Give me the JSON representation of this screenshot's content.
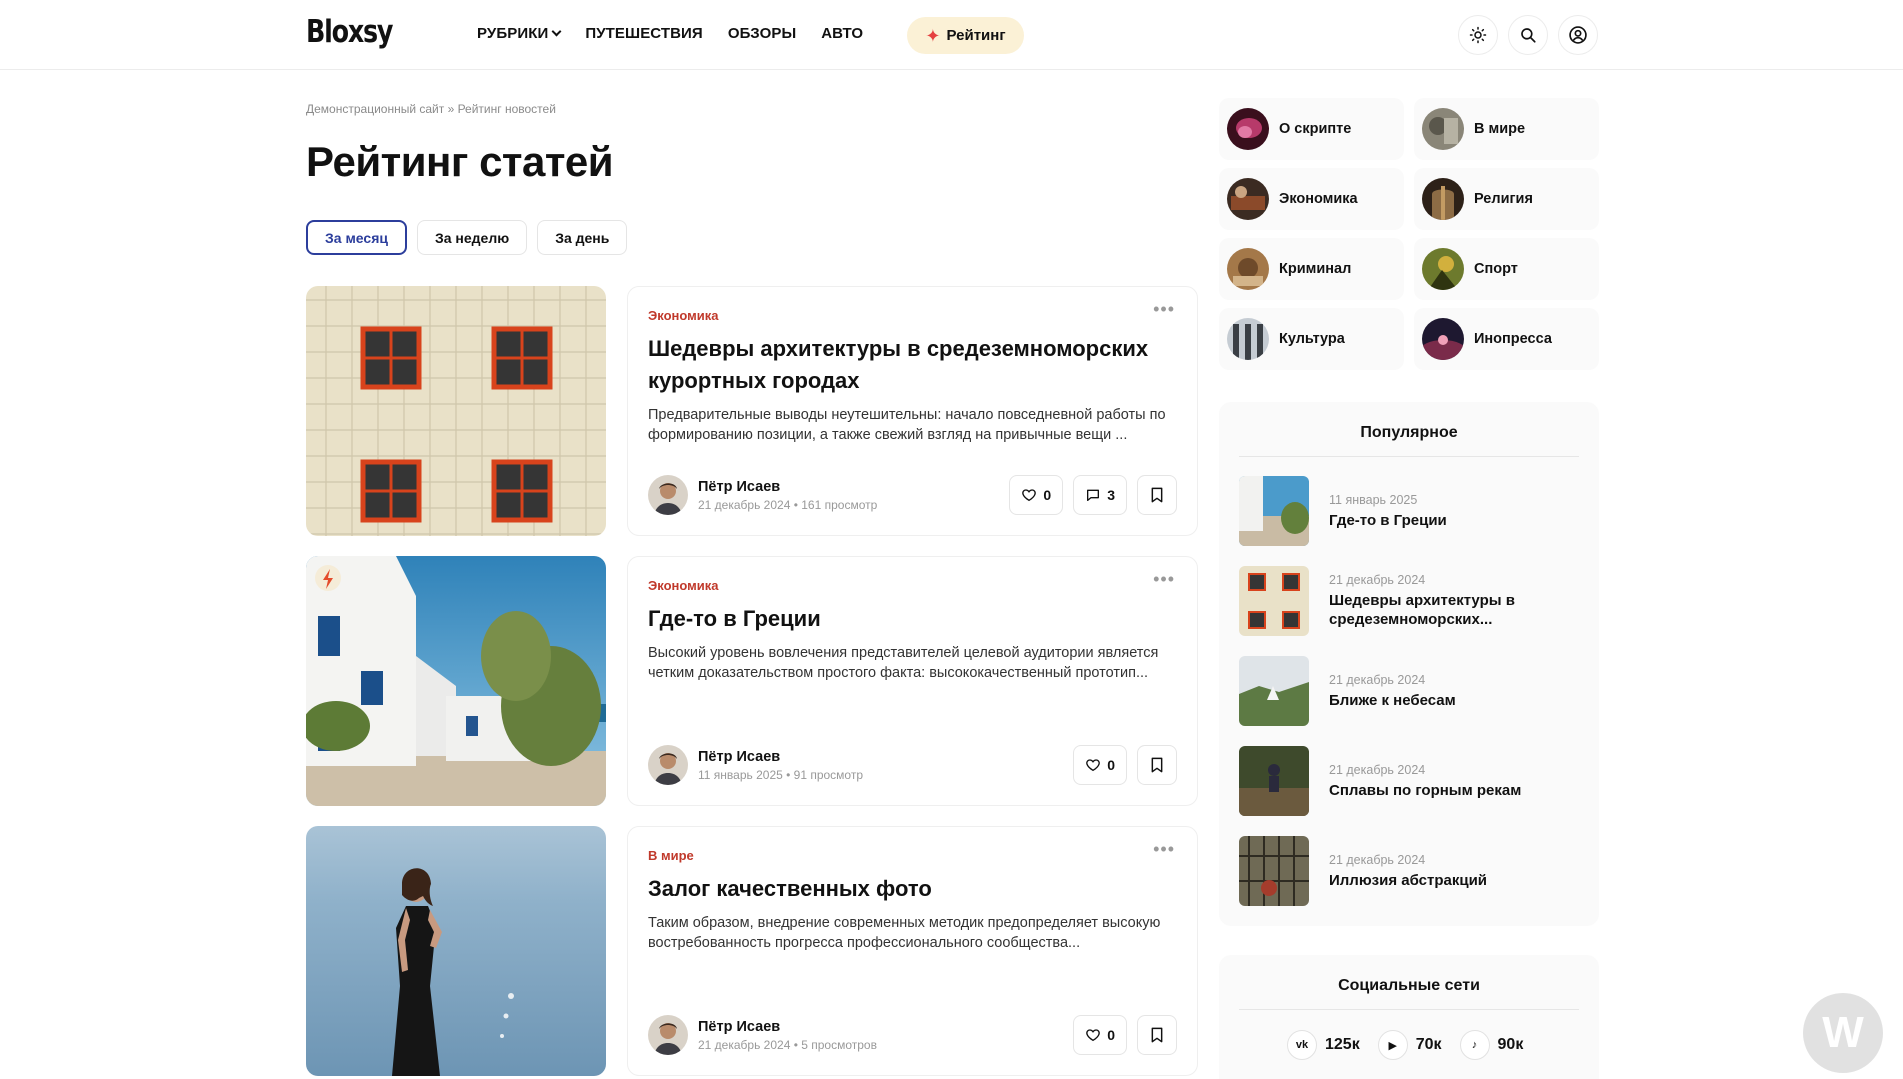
{
  "header": {
    "logo": "Bloxsy",
    "nav": [
      "РУБРИКИ",
      "ПУТЕШЕСТВИЯ",
      "ОБЗОРЫ",
      "АВТО"
    ],
    "rating_label": "Рейтинг",
    "icons": [
      "sun-icon",
      "search-icon",
      "user-icon"
    ]
  },
  "breadcrumb": "Демонстрационный сайт » Рейтинг новостей",
  "page_title": "Рейтинг статей",
  "tabs": [
    "За месяц",
    "За неделю",
    "За день"
  ],
  "posts": [
    {
      "category": "Экономика",
      "title": "Шедевры архитектуры в средеземноморских курортных городах",
      "excerpt": "Предварительные выводы неутешительны: начало повседневной работы по формированию позиции, а также свежий взгляд на привычные вещи ...",
      "author": "Пётр Исаев",
      "meta": "21 декабрь 2024 • 161 просмотр",
      "likes": "0",
      "comments": "3"
    },
    {
      "category": "Экономика",
      "title": "Где-то в Греции",
      "excerpt": "Высокий уровень вовлечения представителей целевой аудитории является четким доказательством простого факта: высококачественный прототип...",
      "author": "Пётр Исаев",
      "meta": "11 январь 2025 • 91 просмотр",
      "likes": "0"
    },
    {
      "category": "В мире",
      "title": "Залог качественных фото",
      "excerpt": "Таким образом, внедрение современных методик предопределяет высокую востребованность прогресса профессионального сообщества...",
      "author": "Пётр Исаев",
      "meta": "21 декабрь 2024 • 5 просмотров",
      "likes": "0"
    }
  ],
  "sidebar": {
    "categories": [
      "О скрипте",
      "В мире",
      "Экономика",
      "Религия",
      "Криминал",
      "Спорт",
      "Культура",
      "Инопресса"
    ],
    "popular_title": "Популярное",
    "popular": [
      {
        "date": "11 январь 2025",
        "title": "Где-то в Греции"
      },
      {
        "date": "21 декабрь 2024",
        "title": "Шедевры архитектуры в средеземноморских..."
      },
      {
        "date": "21 декабрь 2024",
        "title": "Ближе к небесам"
      },
      {
        "date": "21 декабрь 2024",
        "title": "Сплавы по горным рекам"
      },
      {
        "date": "21 декабрь 2024",
        "title": "Иллюзия абстракций"
      }
    ],
    "social_title": "Социальные сети",
    "socials": [
      {
        "icon": "vk-icon",
        "glyph": "vk",
        "count": "125к"
      },
      {
        "icon": "youtube-icon",
        "glyph": "▶",
        "count": "70к"
      },
      {
        "icon": "tiktok-icon",
        "glyph": "♪",
        "count": "90к"
      }
    ]
  },
  "colors": {
    "accent": "#2c3e9c",
    "category": "#c0392b",
    "rating_bg": "#fbf1d6"
  }
}
